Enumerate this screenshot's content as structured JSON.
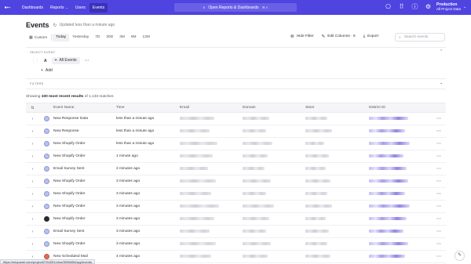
{
  "nav": {
    "items": [
      {
        "label": "Dashboards",
        "active": false,
        "caret": false
      },
      {
        "label": "Reports",
        "active": false,
        "caret": true
      },
      {
        "label": "Users",
        "active": false,
        "caret": false
      },
      {
        "label": "Events",
        "active": true,
        "caret": false
      }
    ],
    "search_label": "Open Reports & Dashboards",
    "search_shortcut": "⌘ K",
    "project_name": "Production",
    "project_sub": "All Project Data"
  },
  "page": {
    "title": "Events",
    "updated": "Updated less than a minute ago"
  },
  "time_filters": [
    "Today",
    "Yesterday",
    "7D",
    "30D",
    "3M",
    "6M",
    "12M"
  ],
  "time_custom": "Custom",
  "time_active": "Today",
  "actions": {
    "hide_filter": "Hide Filter",
    "edit_columns": "Edit Columns · 6",
    "export": "Export",
    "search_placeholder": "Search events"
  },
  "select_event": {
    "label": "SELECT EVENT",
    "letter": "A",
    "event": "All Events",
    "add": "Add"
  },
  "filters_label": "FILTERS",
  "showing": {
    "prefix": "Showing",
    "bold": "100 most recent results",
    "suffix": "of 1,133 matches"
  },
  "table": {
    "columns": [
      "Event Name",
      "Time",
      "Email",
      "Domain",
      "Store",
      "District ID"
    ],
    "rows": [
      {
        "name": "New Response Data",
        "time": "less than a minute ago",
        "avatar": "default"
      },
      {
        "name": "New Response",
        "time": "less than a minute ago",
        "avatar": "default"
      },
      {
        "name": "New Shopify Order",
        "time": "less than a minute ago",
        "avatar": "default"
      },
      {
        "name": "New Shopify Order",
        "time": "1 minute ago",
        "avatar": "default"
      },
      {
        "name": "Email Survey Sent",
        "time": "2 minutes ago",
        "avatar": "default"
      },
      {
        "name": "New Shopify Order",
        "time": "3 minutes ago",
        "avatar": "default"
      },
      {
        "name": "New Shopify Order",
        "time": "3 minutes ago",
        "avatar": "default"
      },
      {
        "name": "New Shopify Order",
        "time": "3 minutes ago",
        "avatar": "default"
      },
      {
        "name": "New Shopify Order",
        "time": "3 minutes ago",
        "avatar": "dark"
      },
      {
        "name": "Email Survey Sent",
        "time": "3 minutes ago",
        "avatar": "default"
      },
      {
        "name": "New Shopify Order",
        "time": "3 minutes ago",
        "avatar": "default"
      },
      {
        "name": "New Scheduled Mail",
        "time": "4 minutes ago",
        "avatar": "red"
      }
    ]
  },
  "status_url": "https://mixpanel.com/project/2764251/view/3096654/app/events",
  "colors": {
    "brand": "#4f44e0",
    "accent_redacted": "#a69ee9"
  }
}
